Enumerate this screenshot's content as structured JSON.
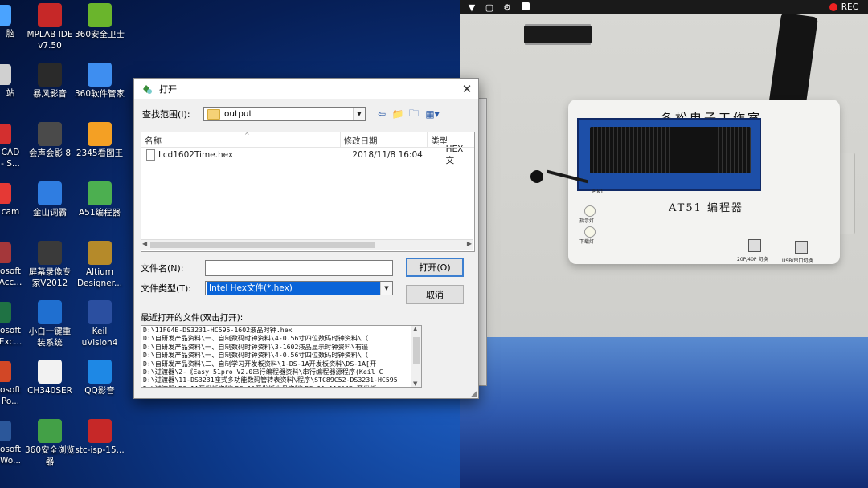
{
  "desktop": {
    "icons": [
      {
        "label": "MPLAB IDE\nv7.50",
        "color": "#c62828"
      },
      {
        "label": "360安全卫士",
        "color": "#6ab52c"
      },
      {
        "label": "暴风影音",
        "color": "#2a2a2a"
      },
      {
        "label": "360软件管家",
        "color": "#3e8ef0"
      },
      {
        "label": "会声会影 8",
        "color": "#4a4a4a"
      },
      {
        "label": "2345看图王",
        "color": "#f4a024"
      },
      {
        "label": "金山词霸",
        "color": "#2f7de1"
      },
      {
        "label": "A51编程器",
        "color": "#4caf50"
      },
      {
        "label": "屏幕录像专\n家V2012",
        "color": "#3a3a3a"
      },
      {
        "label": "Altium\nDesigner...",
        "color": "#b58a2a"
      },
      {
        "label": "小白一键重\n装系统",
        "color": "#1f6fd0"
      },
      {
        "label": "Keil\nuVision4",
        "color": "#2b4fa0"
      },
      {
        "label": "CH340SER",
        "color": "#f2f2f2"
      },
      {
        "label": "QQ影音",
        "color": "#1e88e5"
      },
      {
        "label": "360安全浏览\n器",
        "color": "#43a047"
      },
      {
        "label": "stc-isp-15...",
        "color": "#c62828"
      }
    ],
    "partial_icons": [
      {
        "label": "脑",
        "color": "#4aa3ff"
      },
      {
        "label": "站",
        "color": "#d0d0d0"
      },
      {
        "label": "CAD\n- S...",
        "color": "#d32f2f"
      },
      {
        "label": "cam",
        "color": "#e53935"
      },
      {
        "label": "osoft\nAcc...",
        "color": "#a4373a"
      },
      {
        "label": "osoft\nExc...",
        "color": "#1f7244"
      },
      {
        "label": "osoft\nPo...",
        "color": "#d24726"
      },
      {
        "label": "osoft\nWo...",
        "color": "#2b579a"
      }
    ]
  },
  "dialog": {
    "title": "打开",
    "lookin_label": "查找范围(I):",
    "lookin_value": "output",
    "columns": {
      "name": "名称",
      "date": "修改日期",
      "type": "类型"
    },
    "files": [
      {
        "name": "Lcd1602Time.hex",
        "date": "2018/11/8 16:04",
        "type": "HEX 文"
      }
    ],
    "filename_label": "文件名(N):",
    "filename_value": "",
    "filetype_label": "文件类型(T):",
    "filetype_value": "Intel Hex文件(*.hex)",
    "open_button": "打开(O)",
    "cancel_button": "取消",
    "recent_label": "最近打开的文件(双击打开):",
    "recent_files": [
      "D:\\11F04E-DS3231-HC595-1602液晶时钟.hex",
      "D:\\自研发产品资料\\一、自制数码时钟资料\\4-0.56寸四位数码时钟资料\\（",
      "D:\\自研发产品资料\\一、自制数码时钟资料\\3-1602液晶显示时钟资料\\有遥",
      "D:\\自研发产品资料\\一、自制数码时钟资料\\4-0.56寸四位数码时钟资料\\（",
      "D:\\自研发产品资料\\二、自制学习开发板资料\\1-DS-1A开发板资料\\DS-1A[开",
      "D:\\过渡器\\2-《Easy 51pro V2.0串行编程器资料\\串行编程器源程序(Keil C",
      "D:\\过渡器\\11-DS3231座式多功能数码管转表资料\\程序\\STC89C52-DS3231-HC595",
      "D:\\过渡器\\DS-1A开发板资料\\DS-1A开发板光盘资料\\DS-1A 11F04E 开发板"
    ]
  },
  "camera": {
    "rec_label": "REC",
    "board_title": "冬松电子工作室",
    "board_model": "AT51 编程器",
    "pin_label": "PIN1",
    "led1_label": "指示灯",
    "led2_label": "下载灯",
    "switch1_label": "20P/40P 切换",
    "switch2_label": "USB/串口切换"
  }
}
